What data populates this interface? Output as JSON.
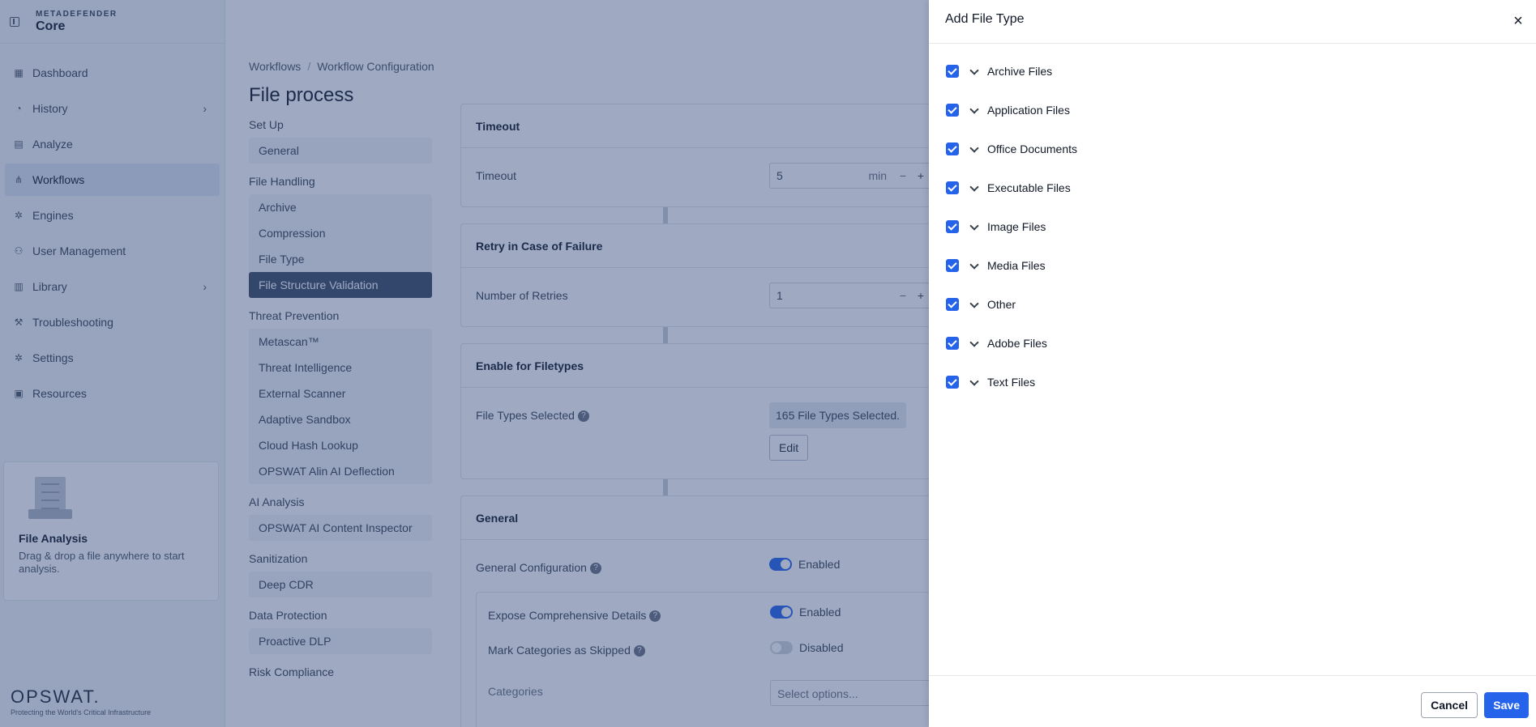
{
  "brand": {
    "small": "METADEFENDER",
    "big": "Core"
  },
  "sidebar": {
    "items": [
      {
        "label": "Dashboard",
        "icon": "dashboard-icon"
      },
      {
        "label": "History",
        "icon": "history-icon",
        "chevron": true
      },
      {
        "label": "Analyze",
        "icon": "document-icon"
      },
      {
        "label": "Workflows",
        "icon": "workflow-icon",
        "active": true
      },
      {
        "label": "Engines",
        "icon": "gear-icon"
      },
      {
        "label": "User Management",
        "icon": "users-icon"
      },
      {
        "label": "Library",
        "icon": "library-icon",
        "chevron": true
      },
      {
        "label": "Troubleshooting",
        "icon": "wrench-icon"
      },
      {
        "label": "Settings",
        "icon": "gear-icon"
      },
      {
        "label": "Resources",
        "icon": "briefcase-icon"
      }
    ],
    "file_card": {
      "title": "File Analysis",
      "text": "Drag & drop a file anywhere to start analysis."
    },
    "footer": {
      "logo": "OPSWAT.",
      "tagline": "Protecting the World's Critical Infrastructure"
    }
  },
  "breadcrumb": {
    "first": "Workflows",
    "separator": "/",
    "second": "Workflow Configuration"
  },
  "page_title": "File process",
  "subnav": {
    "groups": [
      {
        "title": "Set Up",
        "items": [
          "General"
        ]
      },
      {
        "title": "File Handling",
        "items": [
          "Archive",
          "Compression",
          "File Type",
          "File Structure Validation"
        ],
        "selected": "File Structure Validation"
      },
      {
        "title": "Threat Prevention",
        "items": [
          "Metascan™",
          "Threat Intelligence",
          "External Scanner",
          "Adaptive Sandbox",
          "Cloud Hash Lookup",
          "OPSWAT Alin AI Deflection"
        ]
      },
      {
        "title": "AI Analysis",
        "items": [
          "OPSWAT AI Content Inspector"
        ]
      },
      {
        "title": "Sanitization",
        "items": [
          "Deep CDR"
        ]
      },
      {
        "title": "Data Protection",
        "items": [
          "Proactive DLP"
        ]
      },
      {
        "title": "Risk Compliance",
        "items": []
      }
    ]
  },
  "content": {
    "timeout": {
      "header": "Timeout",
      "label": "Timeout",
      "value": "5",
      "unit": "min",
      "minus": "−",
      "plus": "+"
    },
    "retry": {
      "header": "Retry in Case of Failure",
      "label": "Number of Retries",
      "value": "1",
      "minus": "−",
      "plus": "+"
    },
    "filetypes": {
      "header": "Enable for Filetypes",
      "label": "File Types Selected",
      "pill": "165 File Types Selected.",
      "edit": "Edit"
    },
    "general": {
      "header": "General",
      "config_label": "General Configuration",
      "config_state": "Enabled",
      "expose_label": "Expose Comprehensive Details",
      "expose_state": "Enabled",
      "mark_label": "Mark Categories as Skipped",
      "mark_state": "Disabled",
      "categories_label": "Categories",
      "categories_placeholder": "Select options..."
    }
  },
  "drawer": {
    "title": "Add File Type",
    "close": "×",
    "items": [
      {
        "label": "Archive Files",
        "checked": true
      },
      {
        "label": "Application Files",
        "checked": true
      },
      {
        "label": "Office Documents",
        "checked": true
      },
      {
        "label": "Executable Files",
        "checked": true
      },
      {
        "label": "Image Files",
        "checked": true
      },
      {
        "label": "Media Files",
        "checked": true
      },
      {
        "label": "Other",
        "checked": true
      },
      {
        "label": "Adobe Files",
        "checked": true
      },
      {
        "label": "Text Files",
        "checked": true
      }
    ],
    "cancel": "Cancel",
    "save": "Save"
  },
  "colors": {
    "accent": "#2563eb",
    "overlay": "#2a4278",
    "selected_nav": "#3b4a63"
  }
}
